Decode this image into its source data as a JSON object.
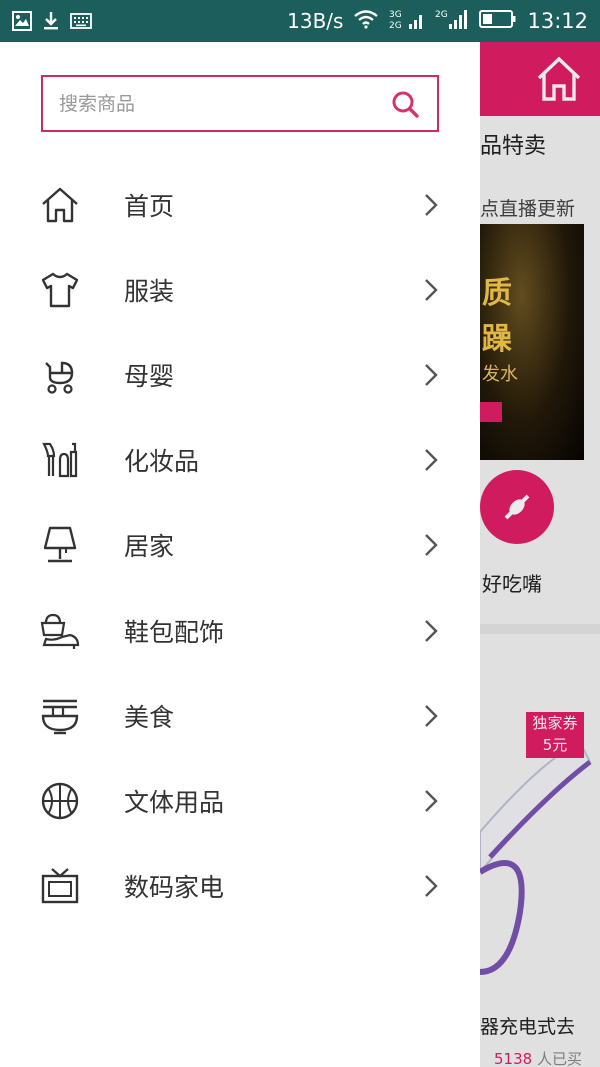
{
  "status_bar": {
    "net_speed": "13B/s",
    "time": "13:12",
    "icons": [
      "image-icon",
      "download-icon",
      "keyboard-icon",
      "wifi-icon",
      "signal-3g-icon",
      "signal-2g-icon",
      "battery-icon"
    ],
    "network_labels": [
      "3G",
      "2G",
      "2G"
    ]
  },
  "drawer": {
    "search": {
      "placeholder": "搜索商品"
    },
    "menu": [
      {
        "label": "首页",
        "icon": "home-icon"
      },
      {
        "label": "服装",
        "icon": "tshirt-icon"
      },
      {
        "label": "母婴",
        "icon": "stroller-icon"
      },
      {
        "label": "化妆品",
        "icon": "cosmetics-icon"
      },
      {
        "label": "居家",
        "icon": "lamp-icon"
      },
      {
        "label": "鞋包配饰",
        "icon": "shoe-bag-icon"
      },
      {
        "label": "美食",
        "icon": "noodle-bowl-icon"
      },
      {
        "label": "文体用品",
        "icon": "basketball-icon"
      },
      {
        "label": "数码家电",
        "icon": "tv-icon"
      }
    ]
  },
  "background": {
    "section_title": "品特卖",
    "update_text": "点直播更新",
    "banner_line1": "质",
    "banner_line2": "躁",
    "banner_line3": "发水",
    "category_label": "好吃嘴",
    "coupon_line1": "独家券",
    "coupon_line2": "5元",
    "product_title": "器充电式去",
    "sold_count": "5138",
    "sold_suffix": "人已买"
  },
  "colors": {
    "status_bar": "#1b5e5c",
    "accent": "#e21e67",
    "search_border": "#c72d63"
  }
}
